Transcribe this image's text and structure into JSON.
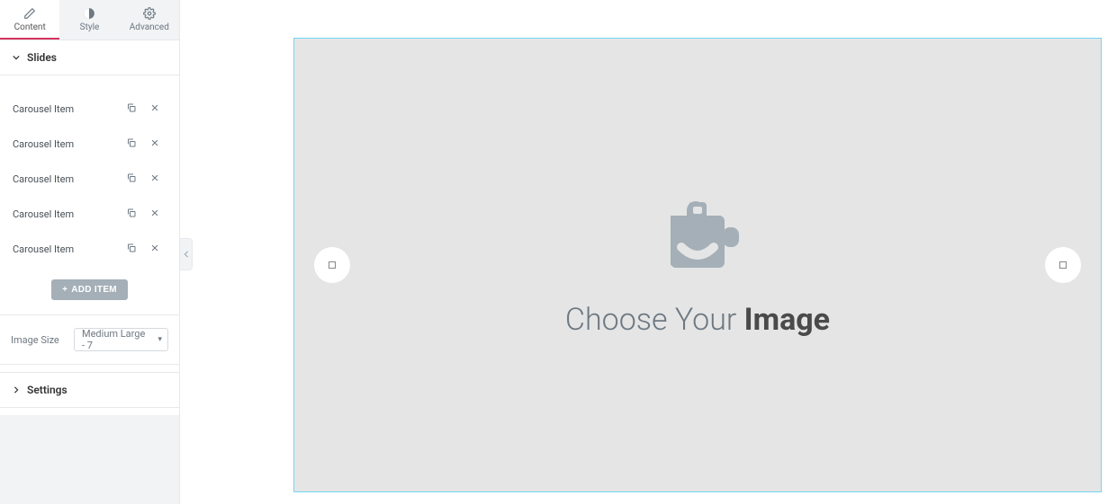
{
  "tabs": {
    "content": "Content",
    "style": "Style",
    "advanced": "Advanced"
  },
  "sections": {
    "slides": "Slides",
    "settings": "Settings"
  },
  "slideItems": [
    {
      "label": "Carousel Item"
    },
    {
      "label": "Carousel Item"
    },
    {
      "label": "Carousel Item"
    },
    {
      "label": "Carousel Item"
    },
    {
      "label": "Carousel Item"
    }
  ],
  "buttons": {
    "addItem": "ADD ITEM"
  },
  "fields": {
    "imageSize": {
      "label": "Image Size",
      "value": "Medium Large - 7"
    }
  },
  "preview": {
    "placeholderPrefix": "Choose Your ",
    "placeholderBold": "Image"
  }
}
